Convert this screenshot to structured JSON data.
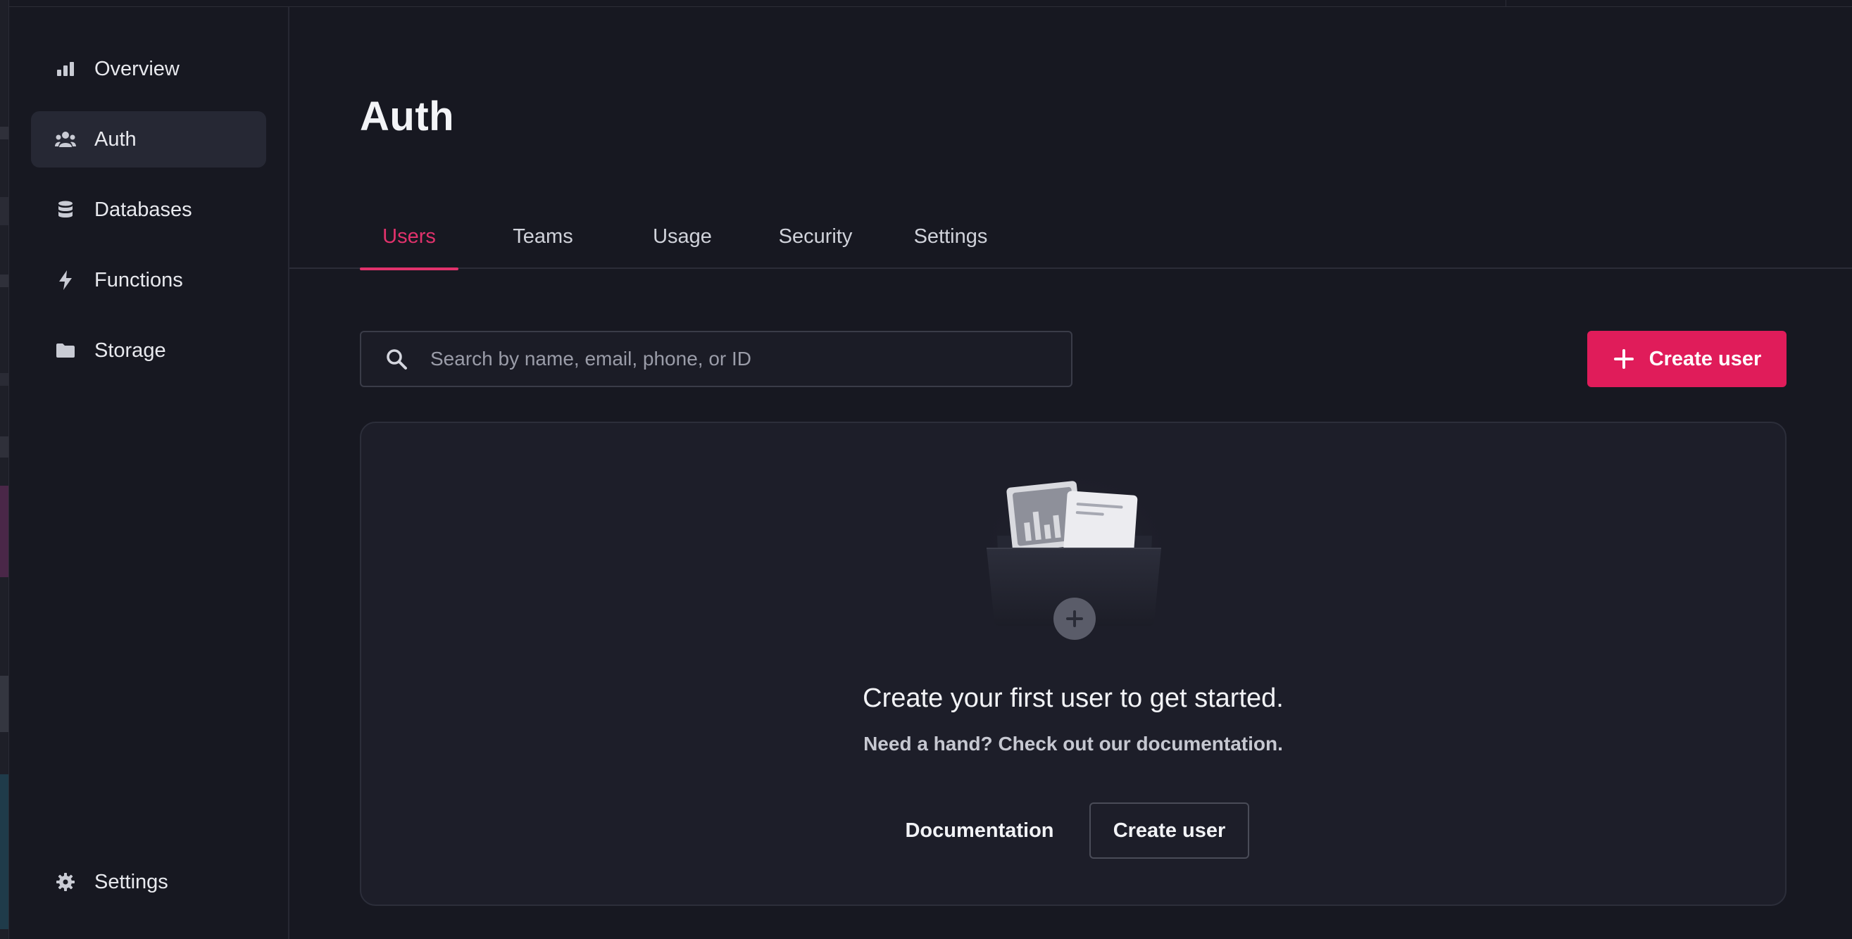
{
  "sidebar": {
    "items": [
      {
        "label": "Overview",
        "icon": "bar-chart-icon"
      },
      {
        "label": "Auth",
        "icon": "users-icon"
      },
      {
        "label": "Databases",
        "icon": "database-icon"
      },
      {
        "label": "Functions",
        "icon": "lightning-icon"
      },
      {
        "label": "Storage",
        "icon": "folder-icon"
      }
    ],
    "settings_label": "Settings",
    "active_item": "Auth"
  },
  "page": {
    "title": "Auth"
  },
  "tabs": [
    {
      "label": "Users"
    },
    {
      "label": "Teams"
    },
    {
      "label": "Usage"
    },
    {
      "label": "Security"
    },
    {
      "label": "Settings"
    }
  ],
  "active_tab": "Users",
  "search": {
    "placeholder": "Search by name, email, phone, or ID",
    "value": ""
  },
  "toolbar": {
    "create_user_label": "Create user"
  },
  "empty_state": {
    "title": "Create your first user to get started.",
    "subtitle": "Need a hand? Check out our documentation.",
    "documentation_label": "Documentation",
    "create_user_label": "Create user"
  },
  "colors": {
    "background": "#171821",
    "accent": "#e01c5a",
    "active_tab": "#e1326c",
    "card": "#1d1e29"
  }
}
